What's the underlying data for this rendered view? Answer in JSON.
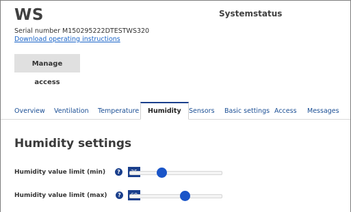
{
  "header": {
    "device_name": "WS",
    "serial": "Serial number M150295222DTESTWS320",
    "download_link": "Download operating instructions",
    "system_title": "Systemstatus",
    "manage_access": "Manage access"
  },
  "tabs": [
    {
      "label": "Overview",
      "active": false
    },
    {
      "label": "Ventilation",
      "active": false
    },
    {
      "label": "Temperature",
      "active": false
    },
    {
      "label": "Humidity",
      "active": true
    },
    {
      "label": "Sensors",
      "active": false
    },
    {
      "label": "Basic settings",
      "active": false
    },
    {
      "label": "Access",
      "active": false
    },
    {
      "label": "Messages",
      "active": false
    }
  ],
  "humidity": {
    "title": "Humidity settings",
    "min": {
      "label": "Humidity value limit (min)",
      "help": "?",
      "value": "35",
      "range": [
        0,
        100
      ]
    },
    "max": {
      "label": "Humidity value limit (max)",
      "help": "?",
      "value": "60",
      "range": [
        0,
        100
      ]
    }
  },
  "colors": {
    "accent": "#1a3f8c",
    "slider_thumb": "#1a55c8",
    "link": "#1a64c8"
  }
}
